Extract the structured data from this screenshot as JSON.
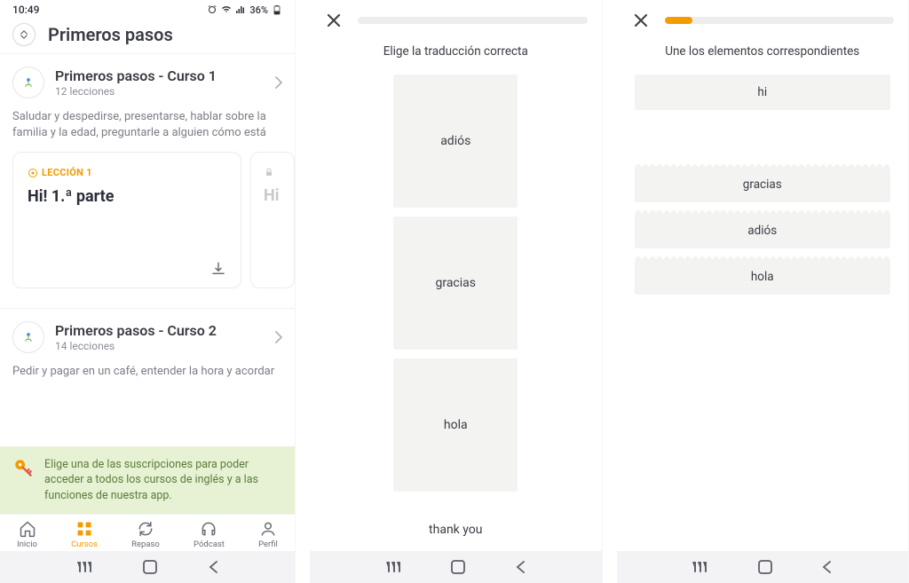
{
  "status": {
    "time": "10:49",
    "battery": "36%"
  },
  "screen1": {
    "title": "Primeros pasos",
    "course1": {
      "title": "Primeros pasos - Curso 1",
      "lessons": "12 lecciones",
      "desc": "Saludar y despedirse, presentarse, hablar sobre la familia y la edad, preguntarle a alguien cómo está"
    },
    "lesson_card": {
      "label": "LECCIÓN 1",
      "title": "Hi! 1.ª parte"
    },
    "lesson_peek": {
      "title": "Hi"
    },
    "course2": {
      "title": "Primeros pasos - Curso 2",
      "lessons": "14 lecciones",
      "desc": "Pedir y pagar en un café, entender la hora y acordar"
    },
    "sub_banner": "Elige una de las suscripciones para poder acceder a todos los cursos de inglés y a las funciones de nuestra app.",
    "nav": {
      "inicio": "Inicio",
      "cursos": "Cursos",
      "repaso": "Repaso",
      "podcast": "Pódcast",
      "perfil": "Perfil"
    }
  },
  "screen2": {
    "prompt": "Elige la traducción correcta",
    "options": [
      "adiós",
      "gracias",
      "hola"
    ],
    "answer": "thank you",
    "progress": 0
  },
  "screen3": {
    "prompt": "Une los elementos correspondientes",
    "top_item": "hi",
    "options": [
      "gracias",
      "adiós",
      "hola"
    ],
    "progress": 12
  }
}
